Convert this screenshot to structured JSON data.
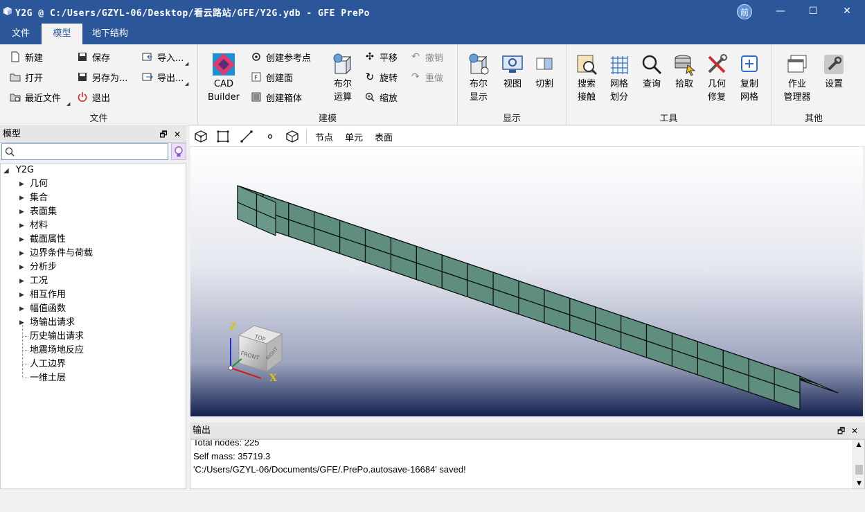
{
  "window": {
    "title": "Y2G @ C:/Users/GZYL-06/Desktop/看云路站/GFE/Y2G.ydb - GFE PrePo",
    "avatar_text": "前",
    "minimize": "—",
    "maximize": "☐",
    "close": "✕"
  },
  "menu": {
    "tabs": [
      {
        "label": "文件",
        "active": false
      },
      {
        "label": "模型",
        "active": true
      },
      {
        "label": "地下结构",
        "active": false
      }
    ]
  },
  "ribbon": {
    "file": {
      "label": "文件",
      "new": "新建",
      "open": "打开",
      "recent": "最近文件",
      "save": "保存",
      "save_as": "另存为...",
      "exit": "退出",
      "import": "导入...",
      "export": "导出..."
    },
    "modeling": {
      "label": "建模",
      "cad_builder_line1": "CAD",
      "cad_builder_line2": "Builder",
      "create_ref_point": "创建参考点",
      "create_surface": "创建面",
      "create_box": "创建箱体",
      "boolean_line1": "布尔",
      "boolean_line2": "运算",
      "translate": "平移",
      "rotate": "旋转",
      "scale": "缩放",
      "undo": "撤销",
      "redo": "重做"
    },
    "display": {
      "label": "显示",
      "boolean_display_line1": "布尔",
      "boolean_display_line2": "显示",
      "view": "视图",
      "cut": "切割"
    },
    "tools": {
      "label": "工具",
      "search_contact_line1": "搜索",
      "search_contact_line2": "接触",
      "mesh_line1": "网格",
      "mesh_line2": "划分",
      "query": "查询",
      "pick": "拾取",
      "geom_repair_line1": "几何",
      "geom_repair_line2": "修复",
      "copy_mesh_line1": "复制",
      "copy_mesh_line2": "网格"
    },
    "other": {
      "label": "其他",
      "job_manager_line1": "作业",
      "job_manager_line2": "管理器",
      "settings": "设置"
    }
  },
  "model_panel": {
    "title": "模型",
    "search_placeholder": "",
    "root": "Y2G",
    "items": [
      {
        "label": "几何",
        "expandable": true
      },
      {
        "label": "集合",
        "expandable": true
      },
      {
        "label": "表面集",
        "expandable": true
      },
      {
        "label": "材料",
        "expandable": true
      },
      {
        "label": "截面属性",
        "expandable": true
      },
      {
        "label": "边界条件与荷载",
        "expandable": true
      },
      {
        "label": "分析步",
        "expandable": true
      },
      {
        "label": "工况",
        "expandable": true
      },
      {
        "label": "相互作用",
        "expandable": true
      },
      {
        "label": "幅值函数",
        "expandable": true
      },
      {
        "label": "场输出请求",
        "expandable": true
      },
      {
        "label": "历史输出请求",
        "expandable": false
      },
      {
        "label": "地震场地反应",
        "expandable": false
      },
      {
        "label": "人工边界",
        "expandable": false
      },
      {
        "label": "一维土层",
        "expandable": false
      }
    ]
  },
  "view_toolbar": {
    "node": "节点",
    "element": "单元",
    "surface": "表面"
  },
  "viewport": {
    "axis_z": "Z",
    "axis_x": "X",
    "cube_top": "TOP",
    "cube_front": "FRONT",
    "cube_right": "RIGHT",
    "mesh_color": "#6b9b8b"
  },
  "output": {
    "title": "输出",
    "lines": [
      "Total nodes:  225",
      "Self mass:     35719.3",
      "'C:/Users/GZYL-06/Documents/GFE/.PrePo.autosave-16684' saved!"
    ]
  }
}
